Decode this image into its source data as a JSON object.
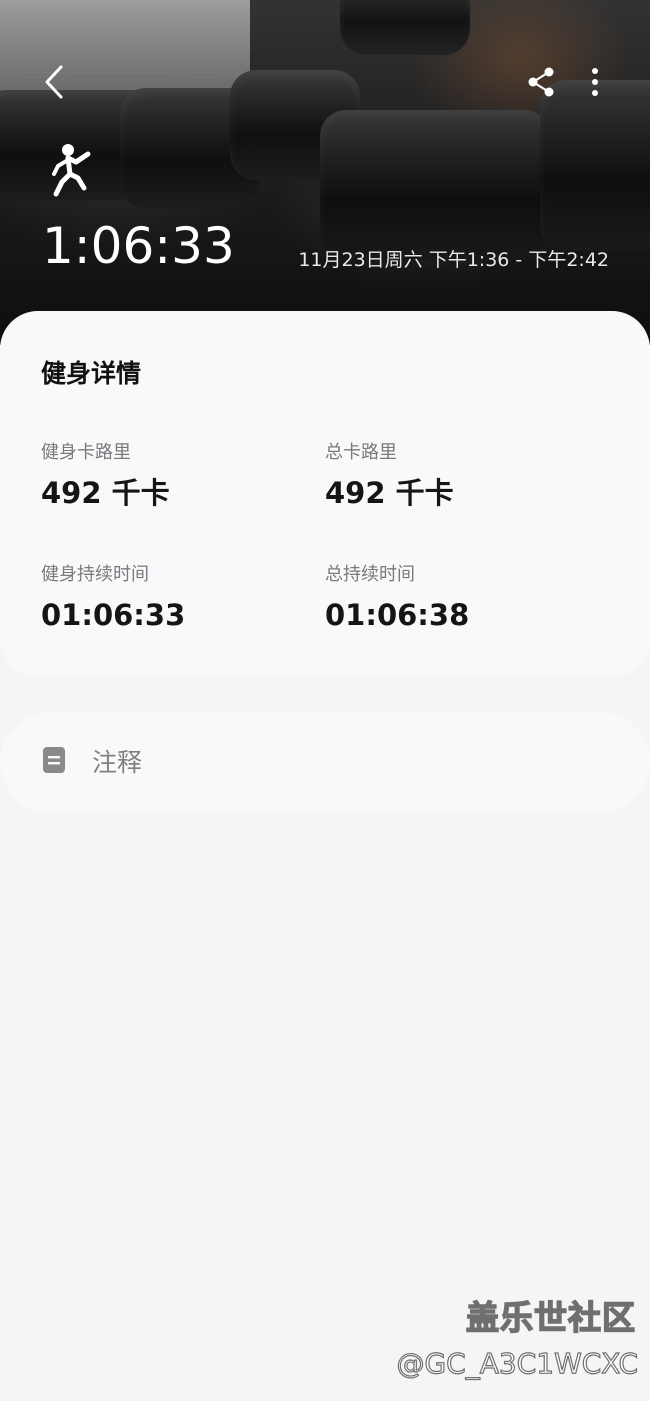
{
  "header": {
    "back_icon": "chevron-left-icon",
    "share_icon": "share-icon",
    "more_icon": "more-vertical-icon",
    "activity_icon": "sports-person-icon",
    "duration": "1:06:33",
    "time_range": "11月23日周六 下午1:36 - 下午2:42"
  },
  "details": {
    "title": "健身详情",
    "stats": [
      {
        "label": "健身卡路里",
        "value": "492 千卡"
      },
      {
        "label": "总卡路里",
        "value": "492 千卡"
      },
      {
        "label": "健身持续时间",
        "value": "01:06:33"
      },
      {
        "label": "总持续时间",
        "value": "01:06:38"
      }
    ]
  },
  "notes": {
    "icon": "note-icon",
    "label": "注释"
  },
  "watermark": {
    "title": "盖乐世社区",
    "handle": "@GC_A3C1WCXC"
  },
  "colors": {
    "background": "#f5f5f7",
    "card": "#f9f9fb",
    "text_primary": "#151515",
    "text_secondary": "#7a7a7d"
  }
}
